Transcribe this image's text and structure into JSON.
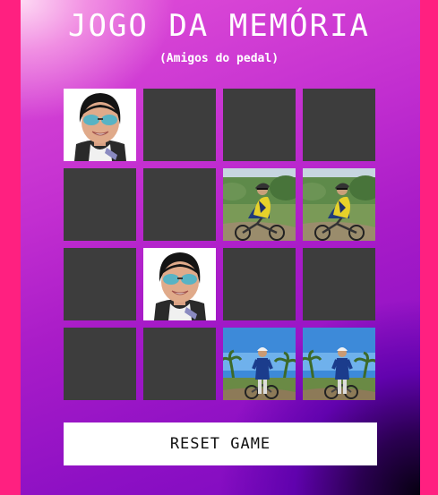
{
  "header": {
    "title": "JOGO DA MEMÓRIA",
    "subtitle": "(Amigos do pedal)"
  },
  "board": {
    "columns": 4,
    "rows": 4,
    "cards": [
      {
        "row": 1,
        "col": 1,
        "state": "revealed",
        "image": "woman-with-sunglasses-photo"
      },
      {
        "row": 1,
        "col": 2,
        "state": "hidden"
      },
      {
        "row": 1,
        "col": 3,
        "state": "hidden"
      },
      {
        "row": 1,
        "col": 4,
        "state": "hidden"
      },
      {
        "row": 2,
        "col": 1,
        "state": "hidden"
      },
      {
        "row": 2,
        "col": 2,
        "state": "hidden"
      },
      {
        "row": 2,
        "col": 3,
        "state": "revealed",
        "image": "mountain-biker-yellow-jersey-photo"
      },
      {
        "row": 2,
        "col": 4,
        "state": "revealed",
        "image": "mountain-biker-yellow-jersey-photo"
      },
      {
        "row": 3,
        "col": 1,
        "state": "hidden"
      },
      {
        "row": 3,
        "col": 2,
        "state": "revealed",
        "image": "woman-with-sunglasses-photo"
      },
      {
        "row": 3,
        "col": 3,
        "state": "hidden"
      },
      {
        "row": 3,
        "col": 4,
        "state": "hidden"
      },
      {
        "row": 4,
        "col": 1,
        "state": "hidden"
      },
      {
        "row": 4,
        "col": 2,
        "state": "hidden"
      },
      {
        "row": 4,
        "col": 3,
        "state": "revealed",
        "image": "cyclist-standing-palm-trees-photo"
      },
      {
        "row": 4,
        "col": 4,
        "state": "revealed",
        "image": "cyclist-standing-palm-trees-photo"
      }
    ]
  },
  "controls": {
    "reset_label": "RESET GAME"
  },
  "colors": {
    "page_background": "#ff2080",
    "card_back": "#3d3d3d",
    "text": "#ffffff"
  }
}
